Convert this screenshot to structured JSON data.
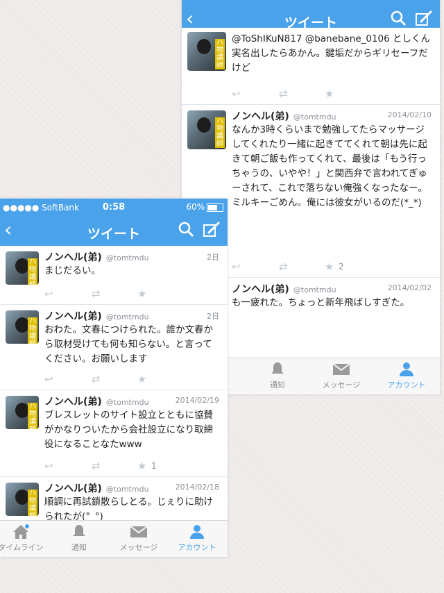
{
  "shotA": {
    "nav": {
      "back": "‹",
      "title": "ツイート",
      "search_icon": "search-icon",
      "compose_icon": "compose-icon"
    },
    "tweets": [
      {
        "name": "",
        "handle": "",
        "date": "",
        "text": "@ToShIKuN817 @banebane_0106 としくん実名出したらあかん。鍵垢だからギリセーフだけど",
        "fav_count": ""
      },
      {
        "name": "ノンヘル(弟)",
        "handle": "@tomtmdu",
        "date": "2014/02/10",
        "text": "なんか3時くらいまで勉強してたらマッサージしてくれたり一緒に起きててくれて朝は先に起きて朝ご飯も作ってくれて、最後は「もう行っちゃうの、いやや！」と関西弁で言われてぎゅーされて、これで落ちない俺強くなったなー。ミルキーごめん。俺には彼女がいるのだ(*_*)",
        "fav_count": "2"
      },
      {
        "name": "ノンヘル(弟)",
        "handle": "@tomtmdu",
        "date": "2014/02/02",
        "text": "も一疲れた。ちょっと新年飛ばしすぎた。",
        "fav_count": ""
      }
    ],
    "tabs": [
      "ン",
      "通知",
      "メッセージ",
      "アカウント"
    ]
  },
  "shotB": {
    "status": {
      "carrier": "●●●●● SoftBank",
      "time": "0:58",
      "battery": "60%"
    },
    "nav": {
      "back": "‹",
      "title": "ツイート"
    },
    "tweets": [
      {
        "name": "ノンヘル(弟)",
        "handle": "@tomtmdu",
        "date": "2日",
        "text": "まじだるい。",
        "fav_count": ""
      },
      {
        "name": "ノンヘル(弟)",
        "handle": "@tomtmdu",
        "date": "2日",
        "text": "おわた。文春につけられた。誰か文春から取材受けても何も知らない。と言ってください。お願いします",
        "fav_count": ""
      },
      {
        "name": "ノンヘル(弟)",
        "handle": "@tomtmdu",
        "date": "2014/02/19",
        "text": "ブレスレットのサイト設立とともに協賛がかなりついたから会社設立になり取締役になることなたwww",
        "fav_count": "1"
      },
      {
        "name": "ノンヘル(弟)",
        "handle": "@tomtmdu",
        "date": "2014/02/18",
        "text": "順調に再試鎖散らしとる。じぇりに助けられたが(°_°)",
        "fav_count": ""
      }
    ],
    "tabs": [
      "タイムライン",
      "通知",
      "メッセージ",
      "アカウント"
    ]
  },
  "avatar_badge": "ハ物講師",
  "colors": {
    "accent": "#4aa3ea",
    "icon_muted": "#c4ccd3"
  }
}
